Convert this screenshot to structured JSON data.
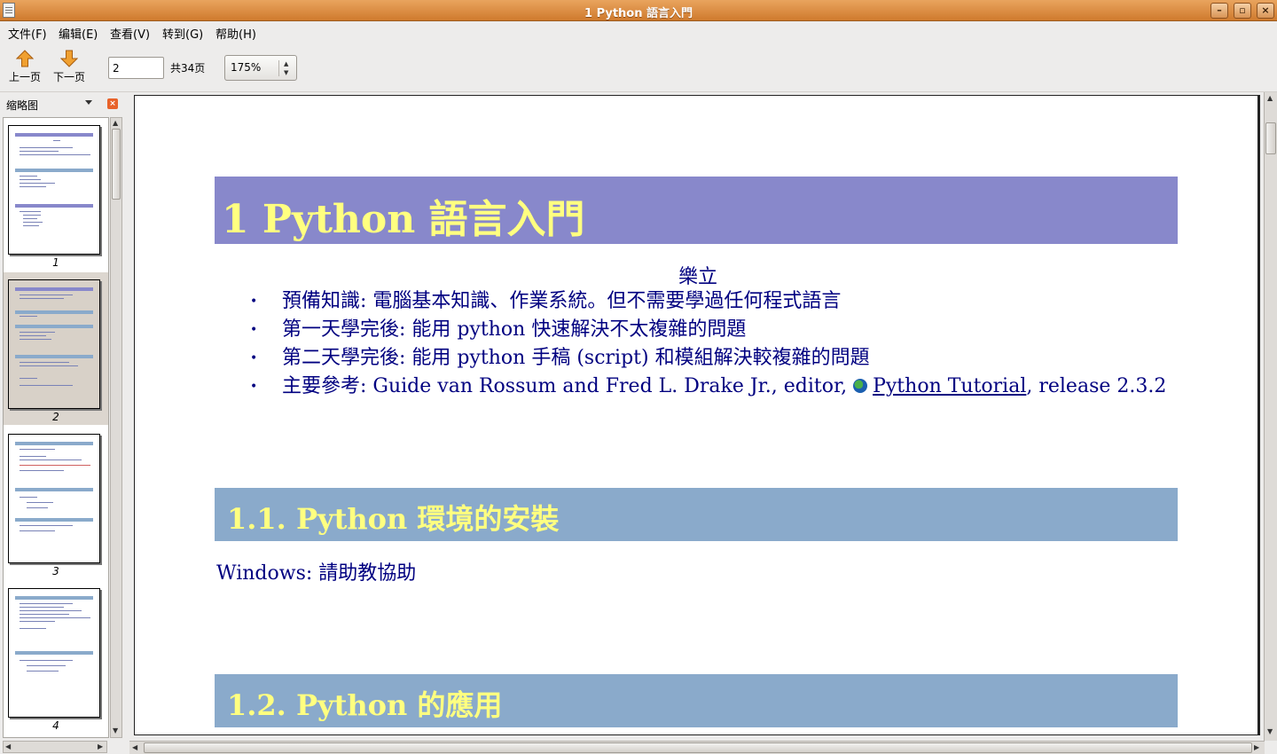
{
  "window": {
    "title": "1 Python 語言入門"
  },
  "menu": [
    "文件(F)",
    "编辑(E)",
    "查看(V)",
    "转到(G)",
    "帮助(H)"
  ],
  "toolbar": {
    "prev_label": "上一页",
    "next_label": "下一页",
    "page_value": "2",
    "page_total": "共34页",
    "zoom": "175%"
  },
  "sidebar": {
    "header": "缩略图",
    "thumbnails": [
      {
        "number": "1"
      },
      {
        "number": "2"
      },
      {
        "number": "3"
      },
      {
        "number": "4"
      }
    ],
    "selected_index": 1
  },
  "document": {
    "title": "1 Python 語言入門",
    "author": "樂立",
    "bullets": [
      {
        "text": "預備知識: 電腦基本知識、作業系統。但不需要學過任何程式語言"
      },
      {
        "text": "第一天學完後: 能用 python 快速解決不太複雜的問題"
      },
      {
        "text": "第二天學完後: 能用 python 手稿 (script) 和模組解決較複雜的問題"
      },
      {
        "text": "主要參考: Guide van Rossum and Fred L. Drake Jr., editor,",
        "link": "Python Tutorial",
        "suffix": ", release 2.3.2"
      }
    ],
    "section1": "1.1. Python 環境的安裝",
    "section1_text": "Windows: 請助教協助",
    "section2": "1.2. Python 的應用"
  },
  "colors": {
    "title_bar": "#d98a3f",
    "h1_background": "#8888cb",
    "h2_background": "#8aaacb",
    "heading_text": "#ffff80",
    "body_text": "#000080"
  }
}
